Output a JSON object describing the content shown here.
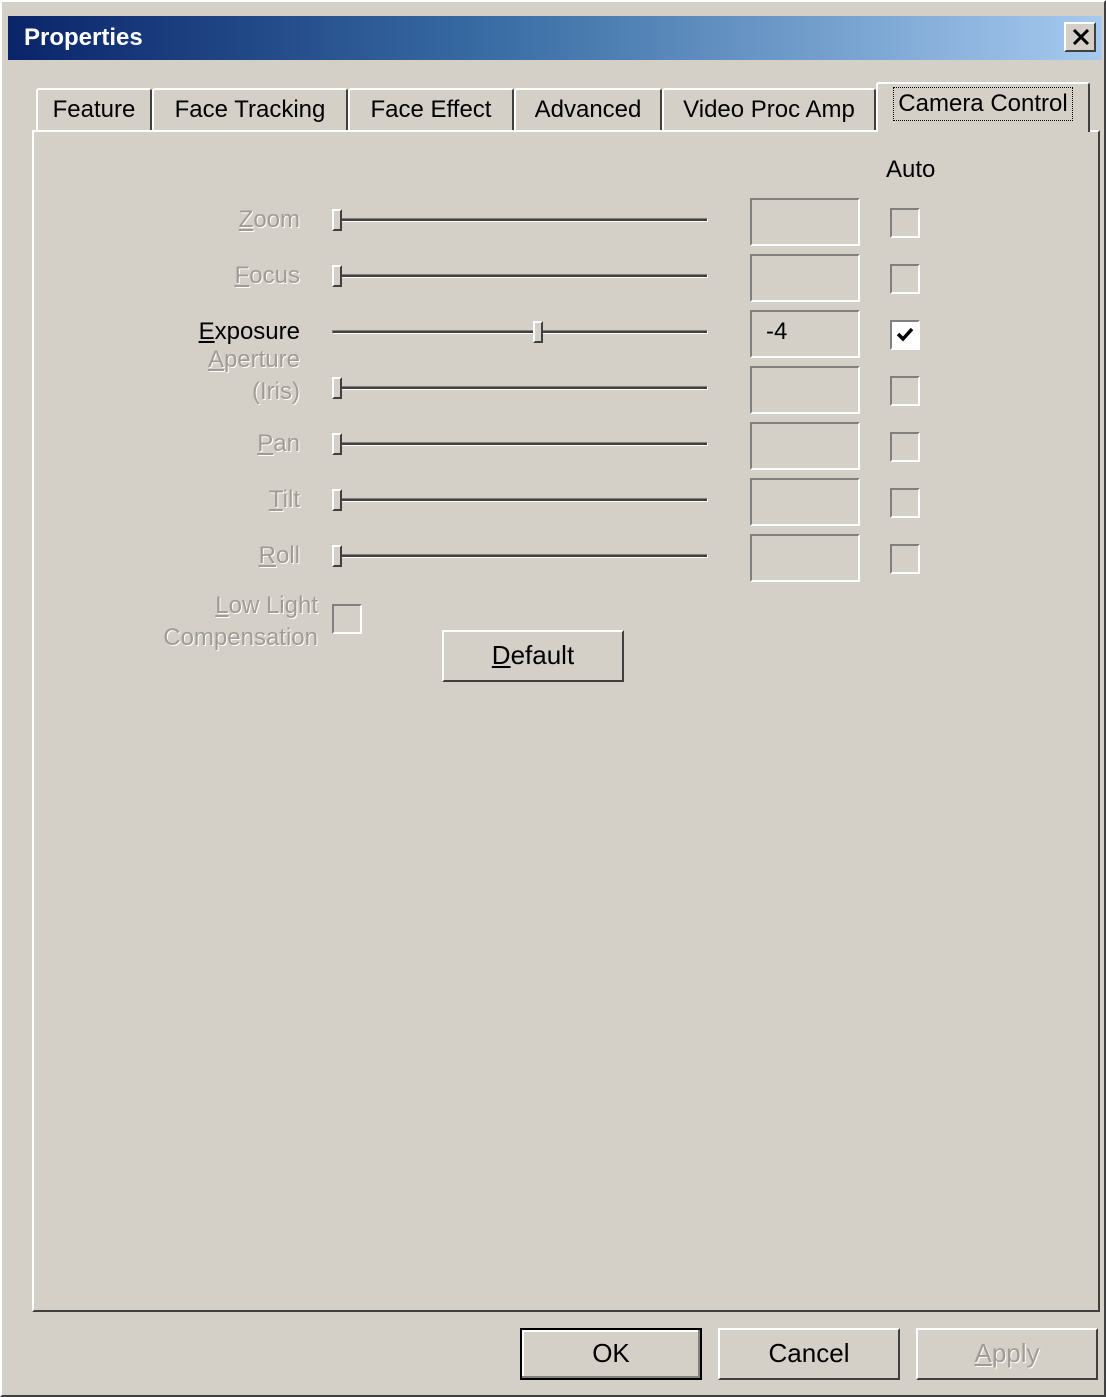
{
  "window": {
    "title": "Properties",
    "close_glyph": "✕"
  },
  "tabs": [
    {
      "label": "Feature",
      "active": false
    },
    {
      "label": "Face Tracking",
      "active": false
    },
    {
      "label": "Face Effect",
      "active": false
    },
    {
      "label": "Advanced",
      "active": false
    },
    {
      "label": "Video Proc Amp",
      "active": false
    },
    {
      "label": "Camera Control",
      "active": true
    }
  ],
  "auto_header": "Auto",
  "controls": [
    {
      "label_pre": "",
      "label_ul": "Z",
      "label_post": "oom",
      "label2": "",
      "enabled": false,
      "value": "",
      "auto": false,
      "slider_position": 0.0
    },
    {
      "label_pre": "",
      "label_ul": "F",
      "label_post": "ocus",
      "label2": "",
      "enabled": false,
      "value": "",
      "auto": false,
      "slider_position": 0.0
    },
    {
      "label_pre": "",
      "label_ul": "E",
      "label_post": "xposure",
      "label2": "",
      "enabled": true,
      "value": "-4",
      "auto": true,
      "slider_position": 0.55
    },
    {
      "label_pre": "",
      "label_ul": "A",
      "label_post": "perture",
      "label2": "(Iris)",
      "enabled": false,
      "value": "",
      "auto": false,
      "slider_position": 0.0
    },
    {
      "label_pre": "",
      "label_ul": "P",
      "label_post": "an",
      "label2": "",
      "enabled": false,
      "value": "",
      "auto": false,
      "slider_position": 0.0
    },
    {
      "label_pre": "",
      "label_ul": "T",
      "label_post": "ilt",
      "label2": "",
      "enabled": false,
      "value": "",
      "auto": false,
      "slider_position": 0.0
    },
    {
      "label_pre": "",
      "label_ul": "R",
      "label_post": "oll",
      "label2": "",
      "enabled": false,
      "value": "",
      "auto": false,
      "slider_position": 0.0
    }
  ],
  "low_light": {
    "label_ul": "L",
    "label_post": "ow Light",
    "label2": "Compensation",
    "checked": false
  },
  "default_button": {
    "label_ul": "D",
    "label_post": "efault"
  },
  "footer": {
    "ok": "OK",
    "cancel": "Cancel",
    "apply_ul": "A",
    "apply_post": "pply"
  },
  "icons": {
    "close": "close-icon",
    "check": "checkmark-icon"
  }
}
